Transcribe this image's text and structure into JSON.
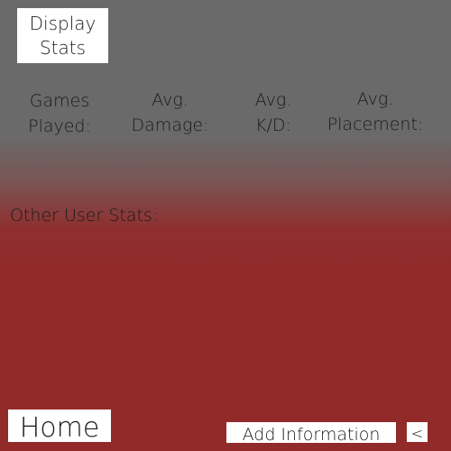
{
  "header": {
    "display_stats_line1": "Display",
    "display_stats_line2": "Stats"
  },
  "stats": {
    "games_played": {
      "line1": "Games",
      "line2": "Played:"
    },
    "avg_damage": {
      "line1": "Avg.",
      "line2": "Damage:"
    },
    "avg_kd": {
      "line1": "Avg.",
      "line2": "K/D:"
    },
    "avg_placement": {
      "line1": "Avg.",
      "line2": "Placement:"
    }
  },
  "other": {
    "label": "Other User Stats:"
  },
  "footer": {
    "home_label": "Home",
    "add_info_label": "Add Information",
    "back_label": "<"
  },
  "colors": {
    "top_background": "#6a6a6a",
    "bottom_background": "#922a2a",
    "button_background": "#ffffff",
    "text": "#1a1a1a"
  }
}
